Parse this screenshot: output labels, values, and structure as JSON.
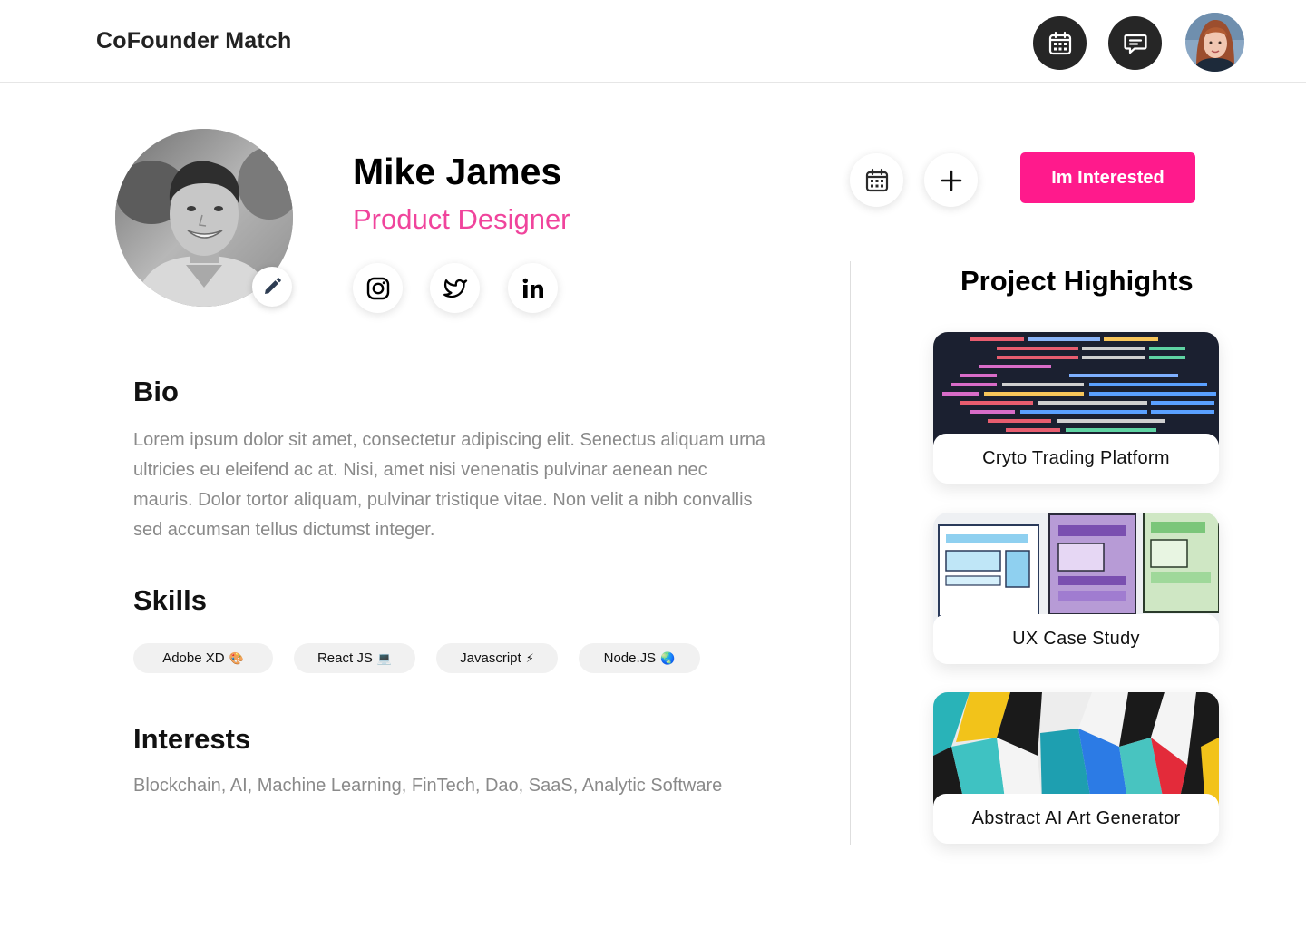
{
  "header": {
    "brand": "CoFounder Match",
    "icons": [
      "calendar-icon",
      "chat-icon"
    ],
    "avatar": "user-avatar"
  },
  "profile": {
    "name": "Mike James",
    "role": "Product Designer",
    "role_color": "#f0449c",
    "socials": [
      "instagram-icon",
      "twitter-icon",
      "linkedin-icon"
    ],
    "interested_label": "Im Interested",
    "accent": "#ff1a8c"
  },
  "bio": {
    "title": "Bio",
    "text": "Lorem ipsum dolor sit amet, consectetur adipiscing elit. Senectus aliquam urna ultricies eu eleifend ac at. Nisi, amet nisi venenatis pulvinar aenean nec mauris. Dolor tortor aliquam, pulvinar tristique vitae. Non velit a nibh convallis sed accumsan tellus dictumst integer."
  },
  "skills": {
    "title": "Skills",
    "items": [
      {
        "label": "Adobe XD",
        "emoji": "🎨"
      },
      {
        "label": "React JS",
        "emoji": "💻"
      },
      {
        "label": "Javascript",
        "emoji": "⚡"
      },
      {
        "label": "Node.JS",
        "emoji": "🌏"
      }
    ]
  },
  "interests": {
    "title": "Interests",
    "text": "Blockchain, AI, Machine Learning, FinTech, Dao, SaaS, Analytic Software"
  },
  "highlights": {
    "title": "Project Highights",
    "cards": [
      {
        "label": "Cryto Trading Platform"
      },
      {
        "label": "UX Case Study"
      },
      {
        "label": "Abstract AI Art Generator"
      }
    ]
  }
}
